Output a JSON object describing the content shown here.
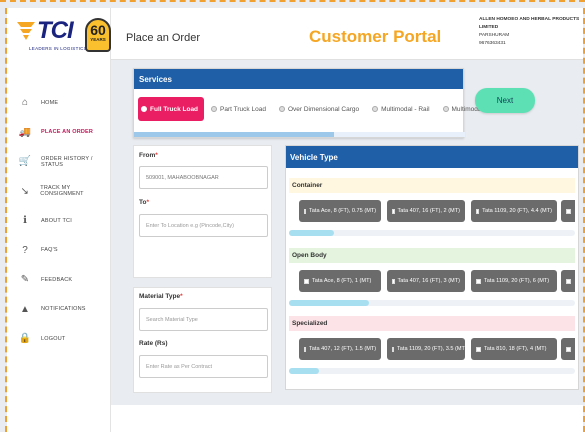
{
  "brand": {
    "logo_text": "TCI",
    "tagline": "LEADERS IN LOGISTICS",
    "badge_number": "60",
    "badge_label": "YEARS",
    "accent_color": "#f5a623",
    "primary_color": "#1e5fa8",
    "active_color": "#e91e63"
  },
  "header": {
    "page_title": "Place an Order",
    "portal_title": "Customer Portal",
    "company_name": "ALLEN HOMOEO AND HERBAL PRODUCTS LIMITED",
    "user_name": "PARSHURAM",
    "phone": "9676363431"
  },
  "sidebar": {
    "items": [
      {
        "label": "HOME",
        "icon": "home-icon",
        "glyph": "⌂"
      },
      {
        "label": "PLACE AN ORDER",
        "icon": "truck-icon",
        "glyph": "🚚",
        "active": true
      },
      {
        "label": "ORDER HISTORY / STATUS",
        "icon": "cart-icon",
        "glyph": "🛒"
      },
      {
        "label": "TRACK MY CONSIGNMENT",
        "icon": "track-icon",
        "glyph": "↘"
      },
      {
        "label": "ABOUT TCI",
        "icon": "info-icon",
        "glyph": "ℹ"
      },
      {
        "label": "FAQ'S",
        "icon": "question-icon",
        "glyph": "?"
      },
      {
        "label": "FEEDBACK",
        "icon": "feedback-icon",
        "glyph": "✎"
      },
      {
        "label": "NOTIFICATIONS",
        "icon": "bell-icon",
        "glyph": "▲"
      },
      {
        "label": "LOGOUT",
        "icon": "lock-icon",
        "glyph": "🔒"
      }
    ]
  },
  "services": {
    "title": "Services",
    "options": [
      {
        "label": "Full Truck Load",
        "selected": true
      },
      {
        "label": "Part Truck Load",
        "selected": false
      },
      {
        "label": "Over Dimensional Cargo",
        "selected": false
      },
      {
        "label": "Multimodal - Rail",
        "selected": false
      },
      {
        "label": "Multimodal - Sea",
        "selected": false
      }
    ],
    "next_label": "Next"
  },
  "form": {
    "from_label": "From",
    "from_value": "509001, MAHABOOBNAGAR",
    "to_label": "To",
    "to_placeholder": "Enter To Location e.g (Pincode,City)",
    "material_label": "Material Type",
    "material_placeholder": "Search Material Type",
    "rate_label": "Rate (Rs)",
    "rate_placeholder": "Enter Rate as Per Contract"
  },
  "vehicle": {
    "title": "Vehicle Type",
    "categories": [
      {
        "name": "Container",
        "chips": [
          "Tata Ace, 8 (FT), 0.75 (MT)",
          "Tata 407, 16 (FT), 2 (MT)",
          "Tata 1109, 20 (FT), 4.4 (MT)"
        ]
      },
      {
        "name": "Open Body",
        "chips": [
          "Tata Ace, 8 (FT), 1 (MT)",
          "Tata 407, 16 (FT), 3 (MT)",
          "Tata 1109, 20 (FT), 6 (MT)"
        ]
      },
      {
        "name": "Specialized",
        "chips": [
          "Tata 407, 12 (FT), 1.5 (MT)",
          "Tata 1109, 20 (FT), 3.5 (MT)",
          "Tata 810, 18 (FT), 4 (MT)"
        ]
      }
    ]
  }
}
